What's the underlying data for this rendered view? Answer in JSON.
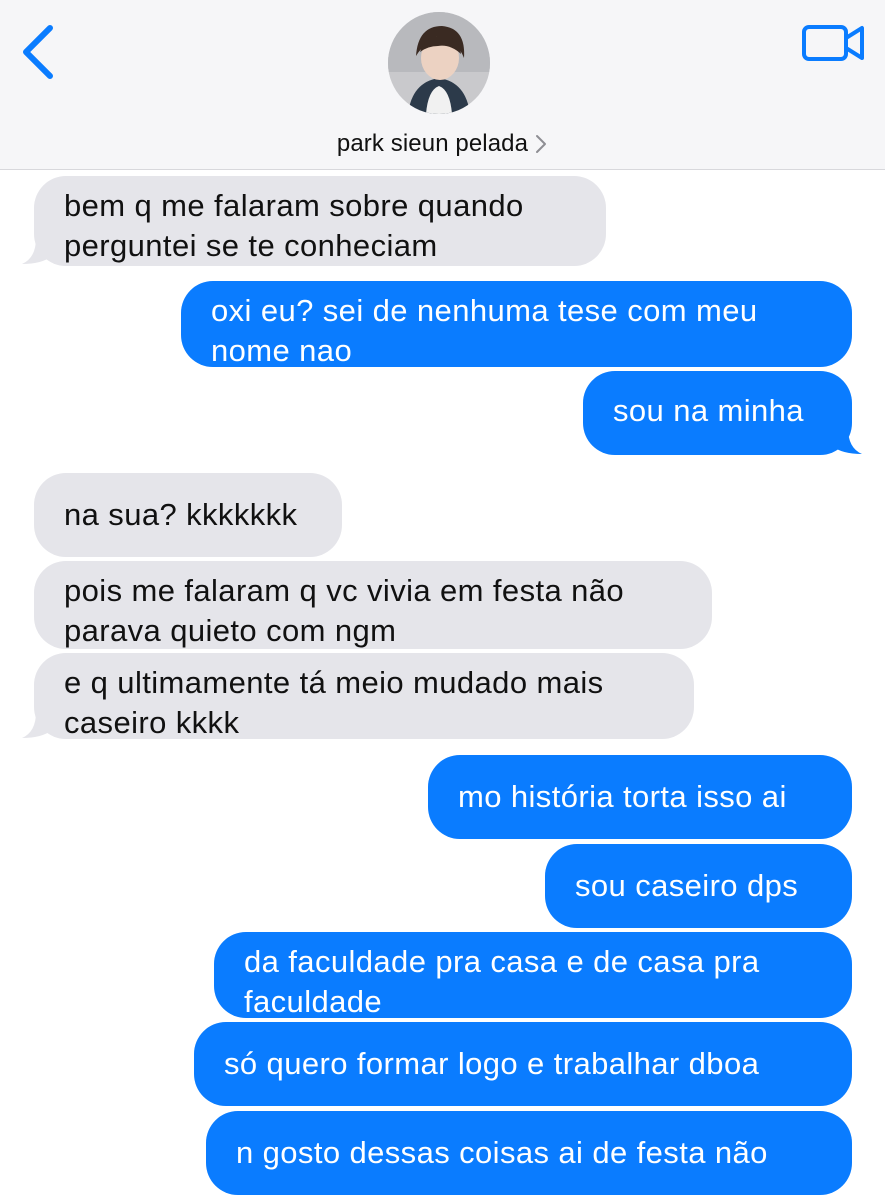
{
  "header": {
    "contact_name": "park sieun pelada",
    "back_icon": "chevron-left-icon",
    "video_icon": "video-camera-icon",
    "accent": "#0a7cff"
  },
  "messages": [
    {
      "from": "them",
      "text": "bem q me falaram sobre quando perguntei se te conheciam",
      "lines": [
        "bem q me falaram sobre quando",
        "perguntei se te conheciam"
      ]
    },
    {
      "from": "me",
      "text": "oxi eu? sei de nenhuma tese com meu nome nao",
      "lines": [
        "oxi eu? sei de nenhuma tese com meu",
        "nome nao"
      ]
    },
    {
      "from": "me",
      "text": "sou na minha",
      "lines": [
        "sou na minha"
      ]
    },
    {
      "from": "them",
      "text": "na sua? kkkkkkk",
      "lines": [
        "na sua? kkkkkkk"
      ]
    },
    {
      "from": "them",
      "text": "pois me falaram q vc vivia em festa não parava quieto com ngm",
      "lines": [
        "pois me falaram q vc vivia em festa não",
        "parava quieto com ngm"
      ]
    },
    {
      "from": "them",
      "text": "e q ultimamente tá meio mudado mais caseiro kkkk",
      "lines": [
        "e q ultimamente tá meio mudado mais",
        "caseiro kkkk"
      ]
    },
    {
      "from": "me",
      "text": "mo história torta isso ai",
      "lines": [
        "mo história torta isso ai"
      ]
    },
    {
      "from": "me",
      "text": "sou caseiro dps",
      "lines": [
        "sou caseiro dps"
      ]
    },
    {
      "from": "me",
      "text": "da faculdade pra casa e de casa pra faculdade",
      "lines": [
        "da faculdade pra casa e de casa pra",
        "faculdade"
      ]
    },
    {
      "from": "me",
      "text": "só quero formar logo e trabalhar dboa",
      "lines": [
        "só quero formar logo e trabalhar dboa"
      ]
    },
    {
      "from": "me",
      "text": "n gosto dessas coisas ai de festa não",
      "lines": [
        "n gosto dessas coisas ai de festa não"
      ]
    }
  ],
  "colors": {
    "outgoing_bubble": "#0a7cff",
    "incoming_bubble": "#e5e5ea"
  }
}
